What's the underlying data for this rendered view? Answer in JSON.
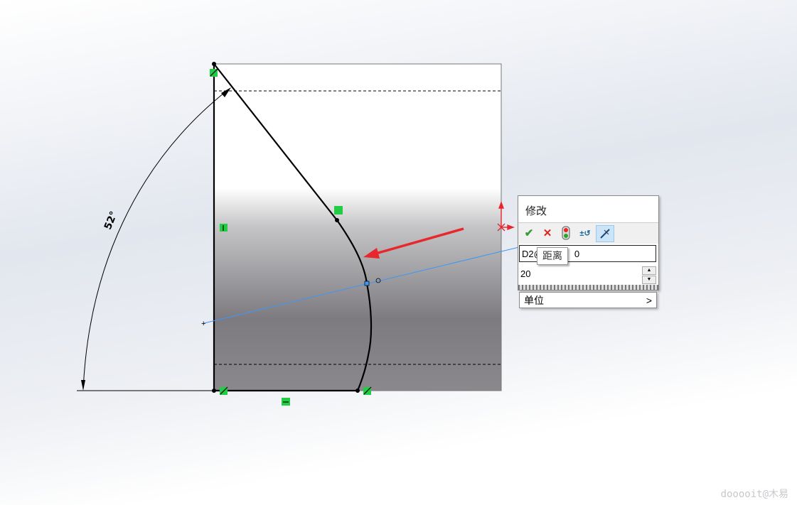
{
  "sketch": {
    "angle_dimension": "52°"
  },
  "modify_dialog": {
    "title": "修改",
    "toolbar": [
      {
        "icon": "check-icon",
        "glyph": "✔"
      },
      {
        "icon": "close-icon",
        "glyph": "✕"
      },
      {
        "icon": "rebuild-traffic-light-icon"
      },
      {
        "icon": "reverse-dimension-icon",
        "glyph": "±↺"
      },
      {
        "icon": "mark-dimension-icon"
      }
    ],
    "name_field_prefix": "D2@",
    "name_field_suffix": "0",
    "value": "20",
    "unit_label": "单位",
    "unit_chevron": ">"
  },
  "tooltip": "距离",
  "watermark": "dooooit@木易",
  "colors": {
    "accent_red": "#e8262b",
    "constraint_green": "#22cc44",
    "dimension_blue": "#3d97f5"
  }
}
